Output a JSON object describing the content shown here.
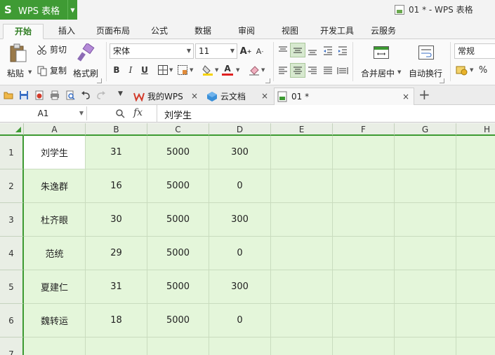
{
  "app": {
    "name": "WPS 表格",
    "doc_title": "01 * - WPS 表格"
  },
  "ribbon_tabs": [
    "开始",
    "插入",
    "页面布局",
    "公式",
    "数据",
    "审阅",
    "视图",
    "开发工具",
    "云服务"
  ],
  "ribbon": {
    "paste": "粘贴",
    "cut": "剪切",
    "copy": "复制",
    "format_painter": "格式刷",
    "font_name": "宋体",
    "font_size": "11",
    "merge_center": "合并居中",
    "wrap_text": "自动换行",
    "number_format": "常规",
    "percent": "%",
    "bold": "B",
    "italic": "I",
    "underline": "U"
  },
  "doc_tabs": [
    {
      "label": "我的WPS"
    },
    {
      "label": "云文档"
    },
    {
      "label": "01 *"
    }
  ],
  "formula_bar": {
    "cell_ref": "A1",
    "fx": "fx",
    "content": "刘学生"
  },
  "columns": [
    "A",
    "B",
    "C",
    "D",
    "E",
    "F",
    "G",
    "H"
  ],
  "rows": [
    {
      "num": "1",
      "cells": [
        "刘学生",
        "31",
        "5000",
        "300"
      ]
    },
    {
      "num": "2",
      "cells": [
        "朱逸群",
        "16",
        "5000",
        "0"
      ]
    },
    {
      "num": "3",
      "cells": [
        "杜齐眼",
        "30",
        "5000",
        "300"
      ]
    },
    {
      "num": "4",
      "cells": [
        "范统",
        "29",
        "5000",
        "0"
      ]
    },
    {
      "num": "5",
      "cells": [
        "夏建仁",
        "31",
        "5000",
        "300"
      ]
    },
    {
      "num": "6",
      "cells": [
        "魏转运",
        "18",
        "5000",
        "0"
      ]
    },
    {
      "num": "7",
      "cells": [
        "",
        "",
        "",
        ""
      ]
    }
  ],
  "colors": {
    "brand": "#3f9b34",
    "grid_bg": "#e4f6da",
    "header_bg": "#e9eee5"
  }
}
